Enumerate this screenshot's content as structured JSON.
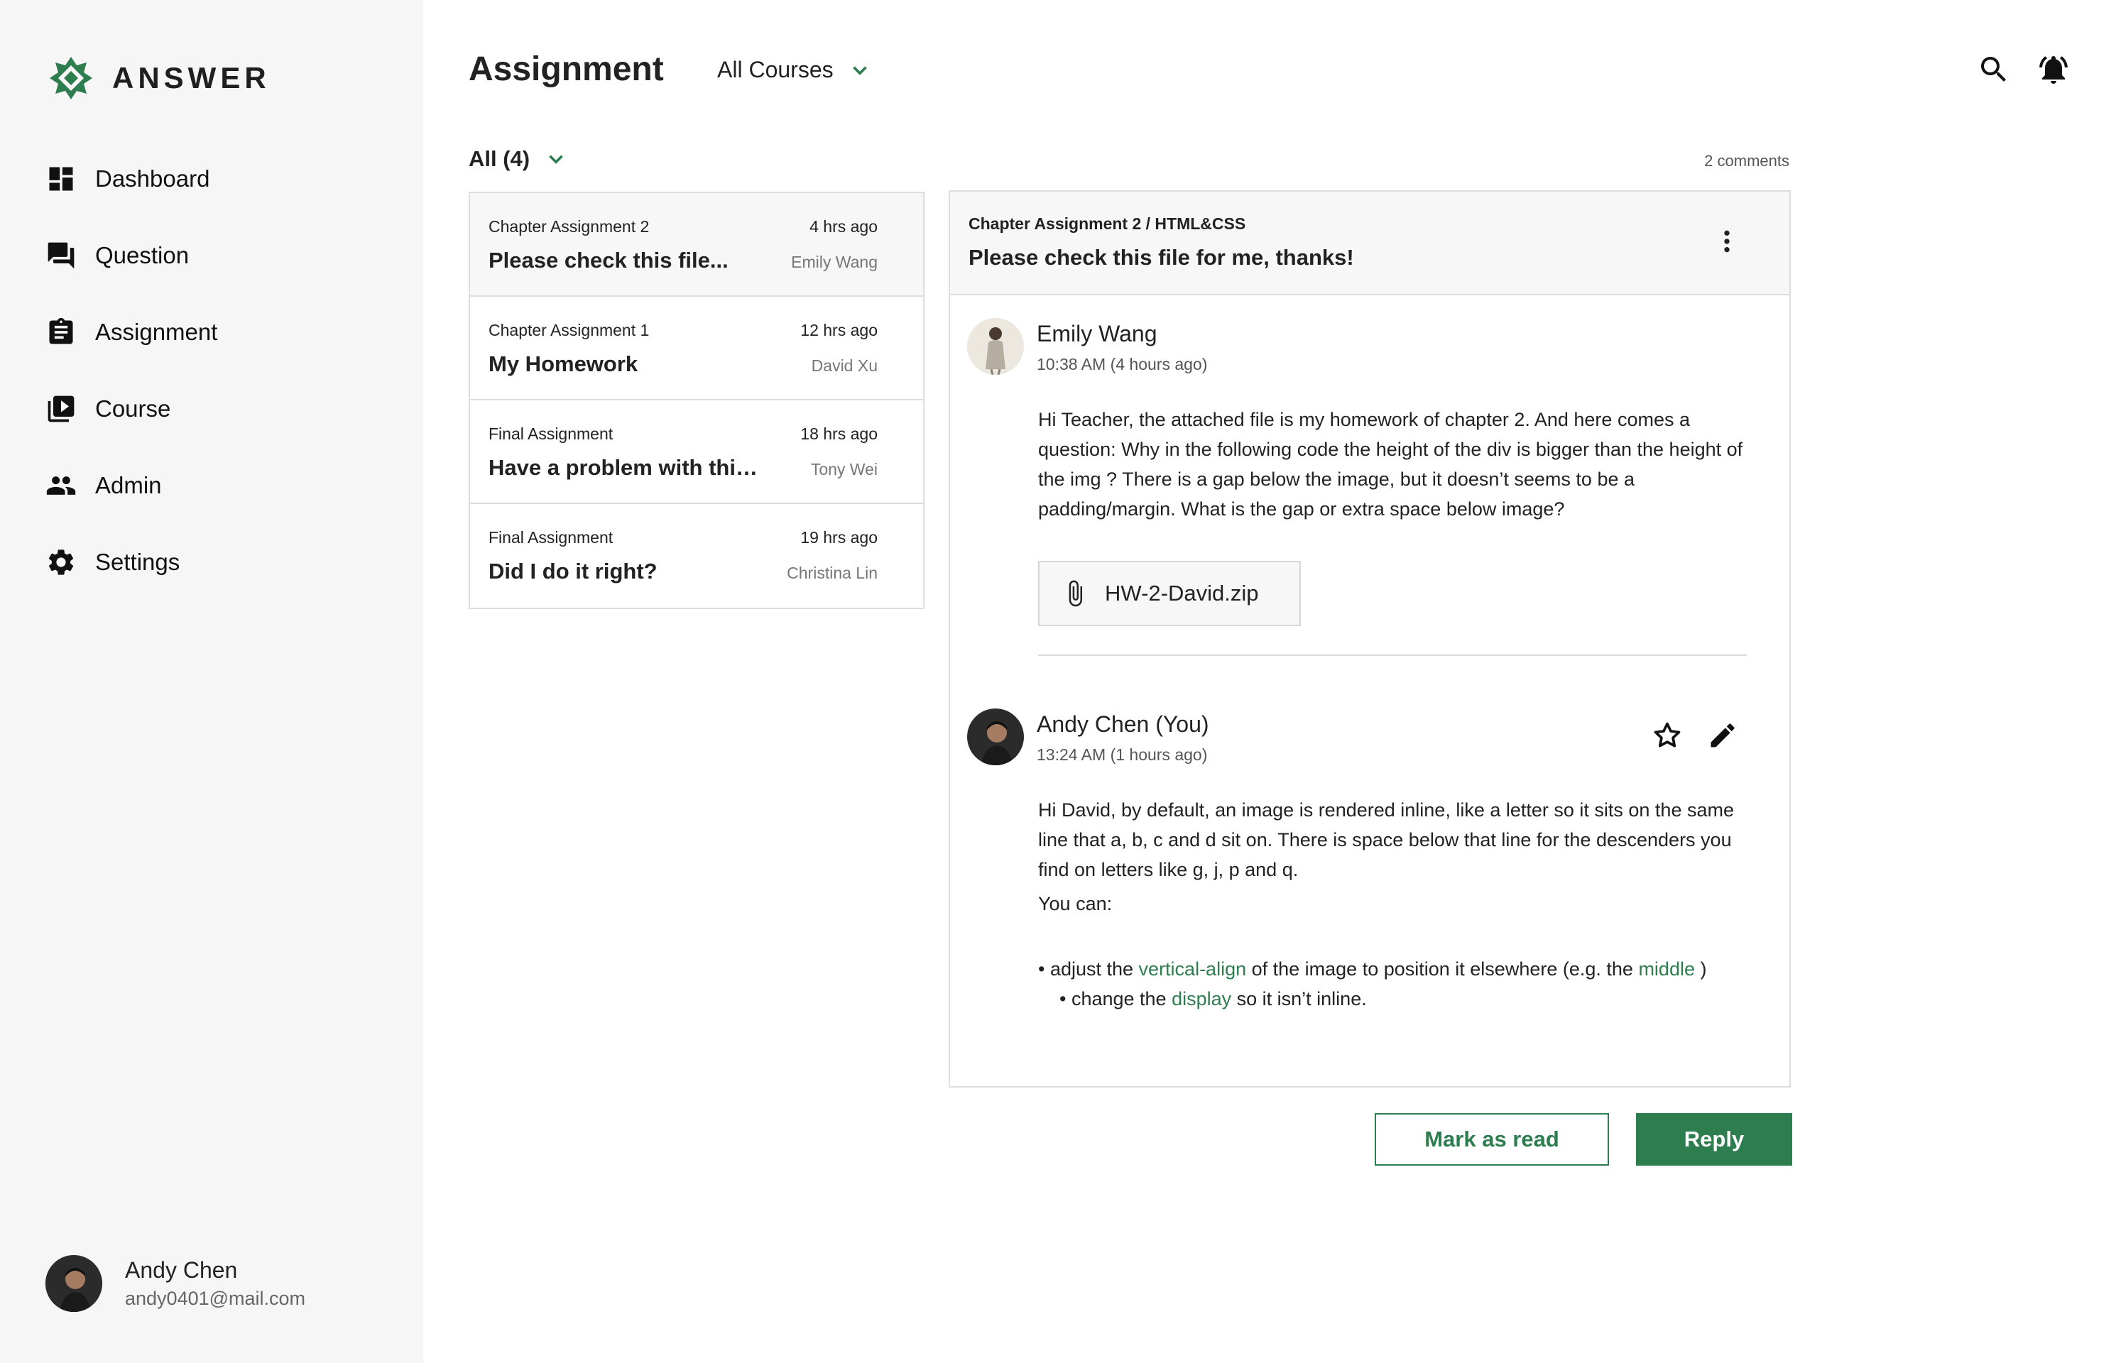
{
  "brand": {
    "name": "ANSWER",
    "accent": "#2e7d4f"
  },
  "sidebar": {
    "items": [
      {
        "label": "Dashboard",
        "icon": "dashboard-icon"
      },
      {
        "label": "Question",
        "icon": "forum-icon"
      },
      {
        "label": "Assignment",
        "icon": "clipboard-icon"
      },
      {
        "label": "Course",
        "icon": "video-library-icon"
      },
      {
        "label": "Admin",
        "icon": "people-icon"
      },
      {
        "label": "Settings",
        "icon": "gear-icon"
      }
    ],
    "user": {
      "name": "Andy Chen",
      "email": "andy0401@mail.com"
    }
  },
  "header": {
    "title": "Assignment",
    "course_filter": "All Courses"
  },
  "filter": {
    "label": "All (4)",
    "comments": "2 comments"
  },
  "list": [
    {
      "chapter": "Chapter Assignment 2",
      "title": "Please check this file...",
      "time": "4 hrs ago",
      "author": "Emily Wang"
    },
    {
      "chapter": "Chapter Assignment 1",
      "title": "My Homework",
      "time": "12 hrs ago",
      "author": "David Xu"
    },
    {
      "chapter": "Final Assignment",
      "title": "Have a problem with this...",
      "time": "18 hrs ago",
      "author": "Tony Wei"
    },
    {
      "chapter": "Final Assignment",
      "title": "Did I do it right?",
      "time": "19 hrs ago",
      "author": "Christina Lin"
    }
  ],
  "detail": {
    "chapter": "Chapter Assignment 2 / HTML&CSS",
    "title": "Please check this file for me, thanks!",
    "comments": [
      {
        "name": "Emily Wang",
        "time": "10:38 AM (4 hours ago)",
        "body": "Hi Teacher, the attached file is my homework of chapter 2. And here comes a question: Why in the following code the height of the div is bigger than the height of the img ? There is a gap below the image, but it doesn’t seems to be a padding/margin. What is the gap or extra space below image?",
        "attachment": "HW-2-David.zip"
      },
      {
        "name": "Andy Chen (You)",
        "time": "13:24 AM (1 hours ago)",
        "body_p1": "Hi David, by default, an image is rendered inline, like a letter so it sits on the same line that a, b, c and d sit on. There is space below that line for the descenders you find on letters like g, j, p and q.",
        "body_p2": "You can:",
        "bullet1": {
          "pre": "• adjust the ",
          "link": "vertical-align",
          "mid": " of the image to position it elsewhere (e.g. the ",
          "link2": "middle",
          "post": " )"
        },
        "bullet2": {
          "pre": "• change the ",
          "link": "display",
          "post": " so it isn’t inline."
        }
      }
    ]
  },
  "buttons": {
    "mark_read": "Mark as read",
    "reply": "Reply"
  }
}
